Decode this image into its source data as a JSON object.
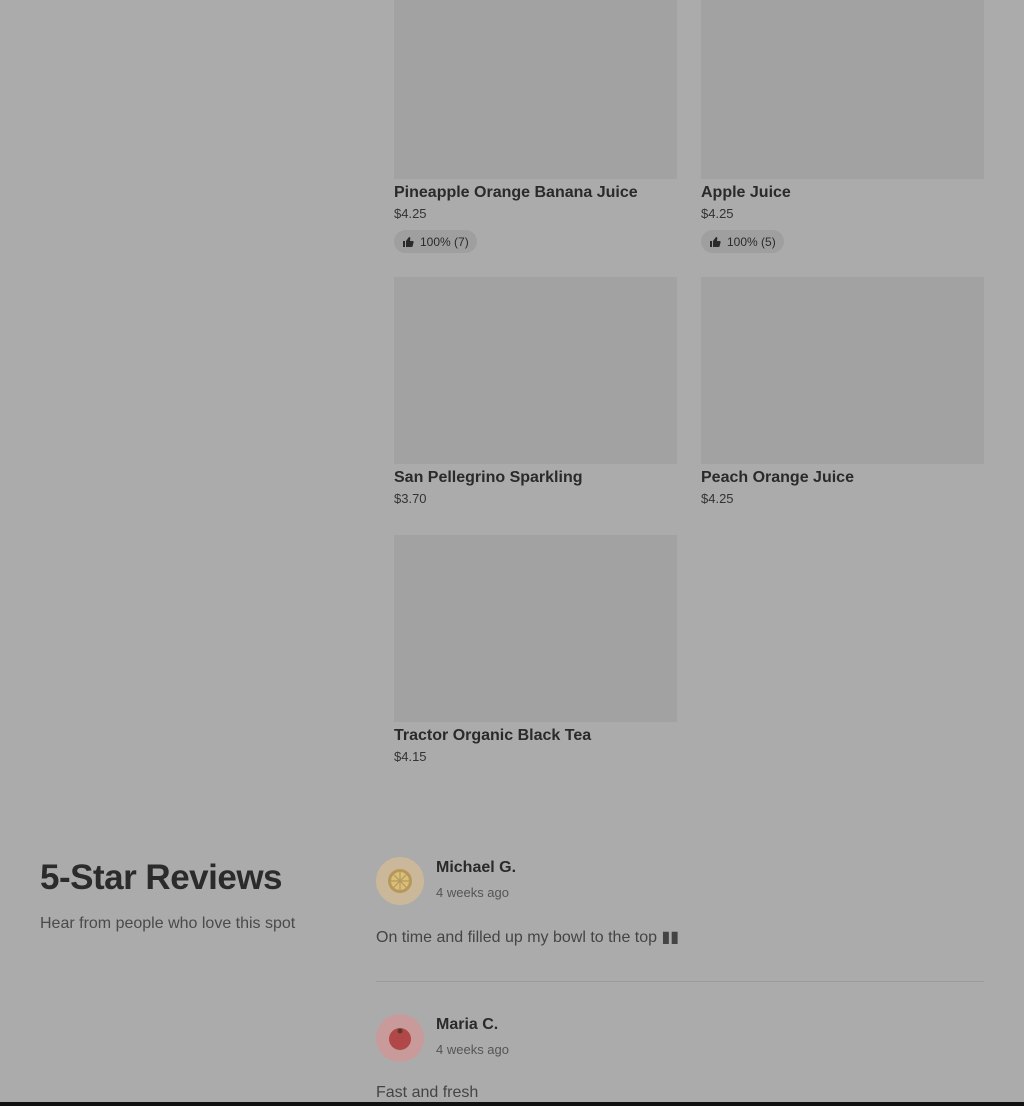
{
  "products": [
    {
      "name": "Pineapple Orange Banana Juice",
      "price": "$4.25",
      "rating": "100% (7)"
    },
    {
      "name": "Apple Juice",
      "price": "$4.25",
      "rating": "100% (5)"
    },
    {
      "name": "San Pellegrino Sparkling",
      "price": "$3.70"
    },
    {
      "name": "Peach Orange Juice",
      "price": "$4.25"
    },
    {
      "name": "Tractor Organic Black Tea",
      "price": "$4.15"
    }
  ],
  "reviews_section": {
    "title": "5-Star Reviews",
    "subtitle": "Hear from people who love this spot"
  },
  "reviews": [
    {
      "name": "Michael G.",
      "time": "4 weeks ago",
      "text": "On time and filled up my bowl to the top ▮▮",
      "avatar_color": "#cbb89a"
    },
    {
      "name": "Maria C.",
      "time": "4 weeks ago",
      "text": "Fast and fresh",
      "avatar_color": "#c89a9a"
    }
  ],
  "icons": {
    "rating": "thumbs-up-icon"
  }
}
